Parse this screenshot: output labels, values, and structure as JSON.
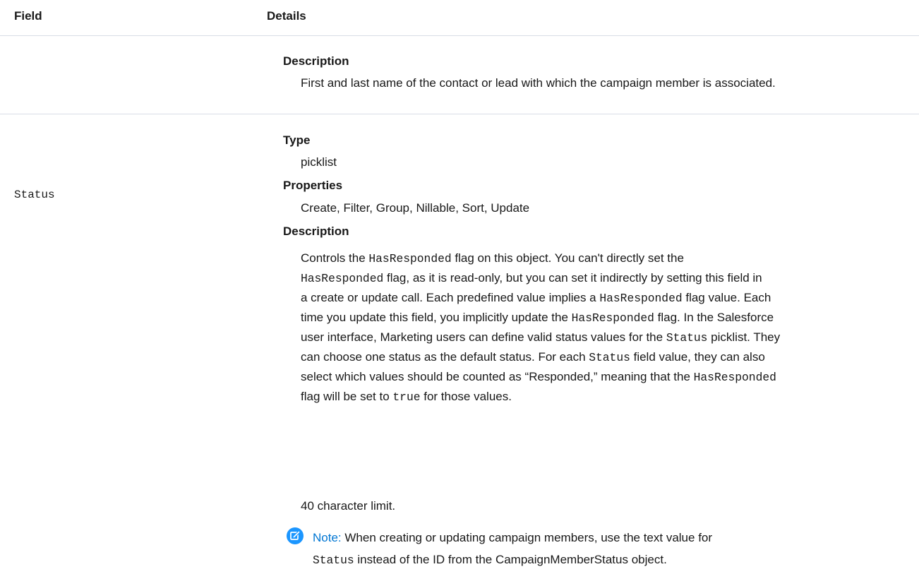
{
  "table": {
    "headers": {
      "field": "Field",
      "details": "Details"
    }
  },
  "row_top": {
    "description_label": "Description",
    "description_text": "First and last name of the contact or lead with which the campaign member is associated."
  },
  "row_status": {
    "field_name": "Status",
    "type_label": "Type",
    "type_value": "picklist",
    "properties_label": "Properties",
    "properties_value": "Create, Filter, Group, Nillable, Sort, Update",
    "description_label": "Description",
    "description": {
      "l1a": "Controls the ",
      "l1b": "HasResponded",
      "l1c": " flag on this object. You can't directly set the",
      "l2a": "HasResponded",
      "l2b": " flag, as it is read-only, but you can set it indirectly by setting this field in",
      "l3a": "a create or update call. Each predefined value implies a ",
      "l3b": "HasResponded",
      "l3c": " flag value. Each",
      "l4a": "time you update this field, you implicitly update the ",
      "l4b": "HasResponded",
      "l4c": " flag. In the Salesforce",
      "l5a": "user interface, Marketing users can define valid status values for the ",
      "l5b": "Status",
      "l5c": " picklist. They",
      "l6a": "can choose one status as the default status. For each ",
      "l6b": "Status",
      "l6c": " field value, they can also",
      "l7a": "select which values should be counted as “Responded,” meaning that the ",
      "l7b": "HasResponded",
      "l8a": "flag will be set to ",
      "l8b": "true",
      "l8c": " for those values."
    },
    "limit_text": "40 character limit.",
    "note": {
      "icon": "edit-note-icon",
      "label": "Note:",
      "l1": " When creating or updating campaign members, use the text value for",
      "l2a": "Status",
      "l2b": " instead of the ID from the CampaignMemberStatus object."
    }
  },
  "colors": {
    "accent": "#0076d3",
    "rule": "#d8dde6",
    "text": "#181818"
  }
}
